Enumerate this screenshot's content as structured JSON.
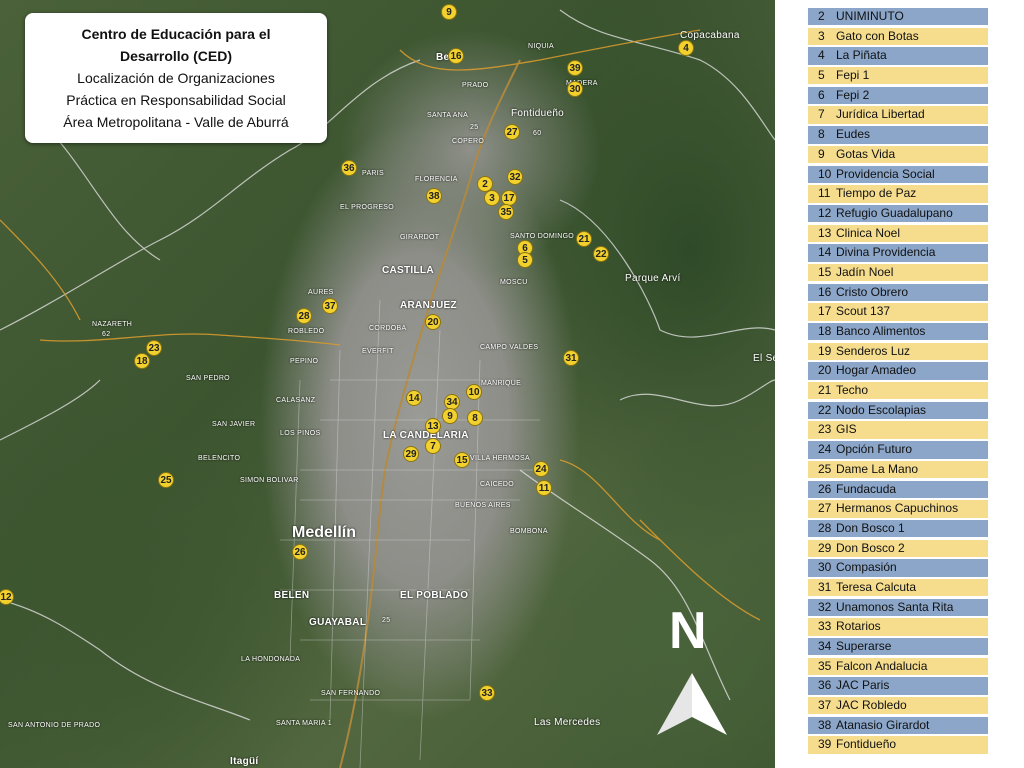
{
  "title_box": {
    "line1": "Centro de Educación para el",
    "line2": "Desarrollo (CED)",
    "line3": "Localización de Organizaciones",
    "line4": "Práctica en Responsabilidad Social",
    "line5": "Área Metropolitana - Valle de Aburrá"
  },
  "north_label": "N",
  "map_labels": {
    "bello": "Bello",
    "copacabana": "Copacabana",
    "niquia": "NIQUIA",
    "madera": "MADERA",
    "fontidueno": "Fontidueño",
    "prado": "PRADO",
    "santa_ana": "SANTA ANA",
    "copero": "COPERO",
    "paris": "PARIS",
    "florencia": "FLORENCIA",
    "el_progreso": "EL PROGRESO",
    "girardot": "GIRARDOT",
    "santo_domingo": "SANTO DOMINGO",
    "castilla": "CASTILLA",
    "moscu": "MOSCU",
    "parque_arvi": "Parque Arví",
    "aures": "AURES",
    "nazareth": "NAZARETH",
    "robledo": "ROBLEDO",
    "aranjuez": "ARANJUEZ",
    "cordoba": "CORDOBA",
    "campo_valdes": "CAMPO VALDES",
    "pepino": "PEPINO",
    "everfit": "EVERFIT",
    "el_se": "El Se",
    "manrique": "MANRIQUE",
    "san_pedro": "SAN PEDRO",
    "calasanz": "CALASANZ",
    "san_javier": "SAN JAVIER",
    "los_pinos": "LOS PINOS",
    "la_candelaria": "LA CANDELARIA",
    "belencito": "BELENCITO",
    "simon_bolivar": "SIMON BOLIVAR",
    "villa_hermosa": "VILLA HERMOSA",
    "caicedo": "CAICEDO",
    "buenos_aires": "BUENOS AIRES",
    "bomboná": "BOMBONA",
    "medellin": "Medellín",
    "belen": "BELEN",
    "el_poblado": "EL POBLADO",
    "guayabal": "GUAYABAL",
    "la_hondonada": "LA HONDONADA",
    "san_fernando": "SAN FERNANDO",
    "santa_maria": "SANTA MARIA 1",
    "san_antonio": "SAN ANTONIO DE PRADO",
    "las_mercedes": "Las Mercedes",
    "itagui": "Itagüí",
    "r25a": "25",
    "r25b": "25",
    "r60": "60",
    "r62": "62"
  },
  "markers": [
    {
      "id": "9"
    },
    {
      "id": "16"
    },
    {
      "id": "4"
    },
    {
      "id": "39"
    },
    {
      "id": "30"
    },
    {
      "id": "27"
    },
    {
      "id": "36"
    },
    {
      "id": "2"
    },
    {
      "id": "32"
    },
    {
      "id": "38"
    },
    {
      "id": "3"
    },
    {
      "id": "17"
    },
    {
      "id": "35"
    },
    {
      "id": "6"
    },
    {
      "id": "5"
    },
    {
      "id": "21"
    },
    {
      "id": "22"
    },
    {
      "id": "37"
    },
    {
      "id": "28"
    },
    {
      "id": "20"
    },
    {
      "id": "23"
    },
    {
      "id": "18"
    },
    {
      "id": "31"
    },
    {
      "id": "14"
    },
    {
      "id": "34"
    },
    {
      "id": "10"
    },
    {
      "id": "9"
    },
    {
      "id": "8"
    },
    {
      "id": "13"
    },
    {
      "id": "7"
    },
    {
      "id": "29"
    },
    {
      "id": "15"
    },
    {
      "id": "24"
    },
    {
      "id": "11"
    },
    {
      "id": "25"
    },
    {
      "id": "26"
    },
    {
      "id": "12"
    },
    {
      "id": "33"
    }
  ],
  "legend": [
    {
      "num": "2",
      "name": "UNIMINUTO"
    },
    {
      "num": "3",
      "name": "Gato con Botas"
    },
    {
      "num": "4",
      "name": "La Piñata"
    },
    {
      "num": "5",
      "name": "Fepi 1"
    },
    {
      "num": "6",
      "name": "Fepi 2"
    },
    {
      "num": "7",
      "name": "Jurídica Libertad"
    },
    {
      "num": "8",
      "name": "Eudes"
    },
    {
      "num": "9",
      "name": "Gotas Vida"
    },
    {
      "num": "10",
      "name": "Providencia Social"
    },
    {
      "num": "11",
      "name": "Tiempo de Paz"
    },
    {
      "num": "12",
      "name": "Refugio Guadalupano"
    },
    {
      "num": "13",
      "name": "Clinica Noel"
    },
    {
      "num": "14",
      "name": "Divina Providencia"
    },
    {
      "num": "15",
      "name": "Jadín Noel"
    },
    {
      "num": "16",
      "name": "Cristo Obrero"
    },
    {
      "num": "17",
      "name": "Scout 137"
    },
    {
      "num": "18",
      "name": "Banco Alimentos"
    },
    {
      "num": "19",
      "name": "Senderos Luz"
    },
    {
      "num": "20",
      "name": "Hogar Amadeo"
    },
    {
      "num": "21",
      "name": "Techo"
    },
    {
      "num": "22",
      "name": "Nodo Escolapias"
    },
    {
      "num": "23",
      "name": "GIS"
    },
    {
      "num": "24",
      "name": "Opción Futuro"
    },
    {
      "num": "25",
      "name": "Dame La Mano"
    },
    {
      "num": "26",
      "name": "Fundacuda"
    },
    {
      "num": "27",
      "name": "Hermanos Capuchinos"
    },
    {
      "num": "28",
      "name": "Don Bosco 1"
    },
    {
      "num": "29",
      "name": "Don Bosco 2"
    },
    {
      "num": "30",
      "name": "Compasión"
    },
    {
      "num": "31",
      "name": "Teresa Calcuta"
    },
    {
      "num": "32",
      "name": "Unamonos Santa Rita"
    },
    {
      "num": "33",
      "name": "Rotarios"
    },
    {
      "num": "34",
      "name": "Superarse"
    },
    {
      "num": "35",
      "name": "Falcon Andalucia"
    },
    {
      "num": "36",
      "name": "JAC Paris"
    },
    {
      "num": "37",
      "name": "JAC Robledo"
    },
    {
      "num": "38",
      "name": "Atanasio Girardot"
    },
    {
      "num": "39",
      "name": "Fontidueño"
    }
  ],
  "colors": {
    "legend_blue": "#8ba6c9",
    "legend_yellow": "#f6dd8e",
    "marker": "#f2d12e"
  }
}
